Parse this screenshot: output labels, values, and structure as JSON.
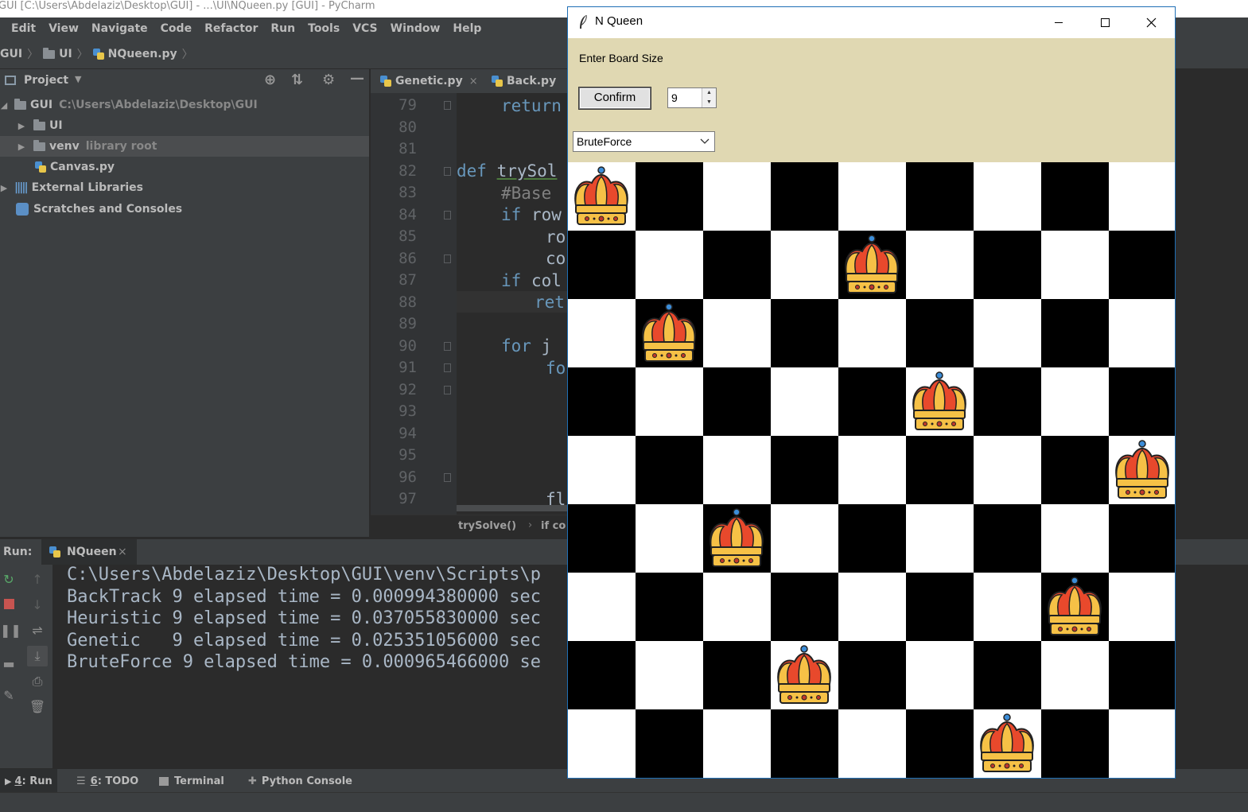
{
  "ide": {
    "window_title": "GUI [C:\\Users\\Abdelaziz\\Desktop\\GUI] - ...\\UI\\NQueen.py [GUI] - PyCharm",
    "menu": [
      "Edit",
      "View",
      "Navigate",
      "Code",
      "Refactor",
      "Run",
      "Tools",
      "VCS",
      "Window",
      "Help"
    ],
    "breadcrumb": [
      "GUI",
      "UI",
      "NQueen.py"
    ],
    "project_panel": {
      "title": "Project",
      "tree": [
        {
          "label": "GUI",
          "hint": "C:\\Users\\Abdelaziz\\Desktop\\GUI",
          "type": "folder"
        },
        {
          "label": "UI",
          "hint": "",
          "type": "folder"
        },
        {
          "label": "venv",
          "hint": "library root",
          "type": "folder"
        },
        {
          "label": "Canvas.py",
          "hint": "",
          "type": "python-file"
        },
        {
          "label": "External Libraries",
          "hint": "",
          "type": "library"
        },
        {
          "label": "Scratches and Consoles",
          "hint": "",
          "type": "scratch"
        }
      ]
    },
    "editor_tabs": [
      {
        "label": "Genetic.py",
        "close": "×"
      },
      {
        "label": "Back.py",
        "close": ""
      }
    ],
    "line_numbers": [
      "79",
      "80",
      "81",
      "82",
      "83",
      "84",
      "85",
      "86",
      "87",
      "88",
      "89",
      "90",
      "91",
      "92",
      "93",
      "94",
      "95",
      "96",
      "97"
    ],
    "code_lines": {
      "l79": "return",
      "l82_kw": "def",
      "l82_fn": "trySol",
      "l83": "#Base",
      "l84_kw": "if",
      "l84_rest": " row",
      "l85": "ro",
      "l86": "co",
      "l87_kw": "if",
      "l87_rest": " col",
      "l88": "ret",
      "l90_kw": "for",
      "l90_rest": " j",
      "l91": "fo",
      "l97": "fl"
    },
    "editor_status": [
      "trySolve()",
      "if co"
    ],
    "run": {
      "label": "Run:",
      "tab": "NQueen",
      "tab_close": "×",
      "console_lines": [
        "C:\\Users\\Abdelaziz\\Desktop\\GUI\\venv\\Scripts\\p",
        "BackTrack 9 elapsed time = 0.000994380000 sec",
        "Heuristic 9 elapsed time = 0.037055830000 sec",
        "Genetic   9 elapsed time = 0.025351056000 sec",
        "BruteForce 9 elapsed time = 0.000965466000 se"
      ]
    },
    "bottom_tabs": [
      {
        "num": "4",
        "label": ": Run"
      },
      {
        "num": "6",
        "label": ": TODO"
      },
      {
        "num": "",
        "label": "Terminal"
      },
      {
        "num": "",
        "label": "Python Console"
      }
    ]
  },
  "app": {
    "title": "N Queen",
    "board_size_label": "Enter Board Size",
    "confirm_label": "Confirm",
    "board_size_value": "9",
    "algorithm": "BruteForce",
    "board": {
      "size": 9,
      "queen_columns": [
        0,
        4,
        1,
        5,
        8,
        2,
        7,
        3,
        6
      ]
    }
  },
  "colors": {
    "ide_background": "#2b2b2b",
    "ide_panel": "#3c3f41",
    "control_panel": "#e0d8b2",
    "dark_square": "#000000",
    "light_square": "#ffffff",
    "crown_red": "#e8492c",
    "crown_gold": "#f6c146"
  }
}
